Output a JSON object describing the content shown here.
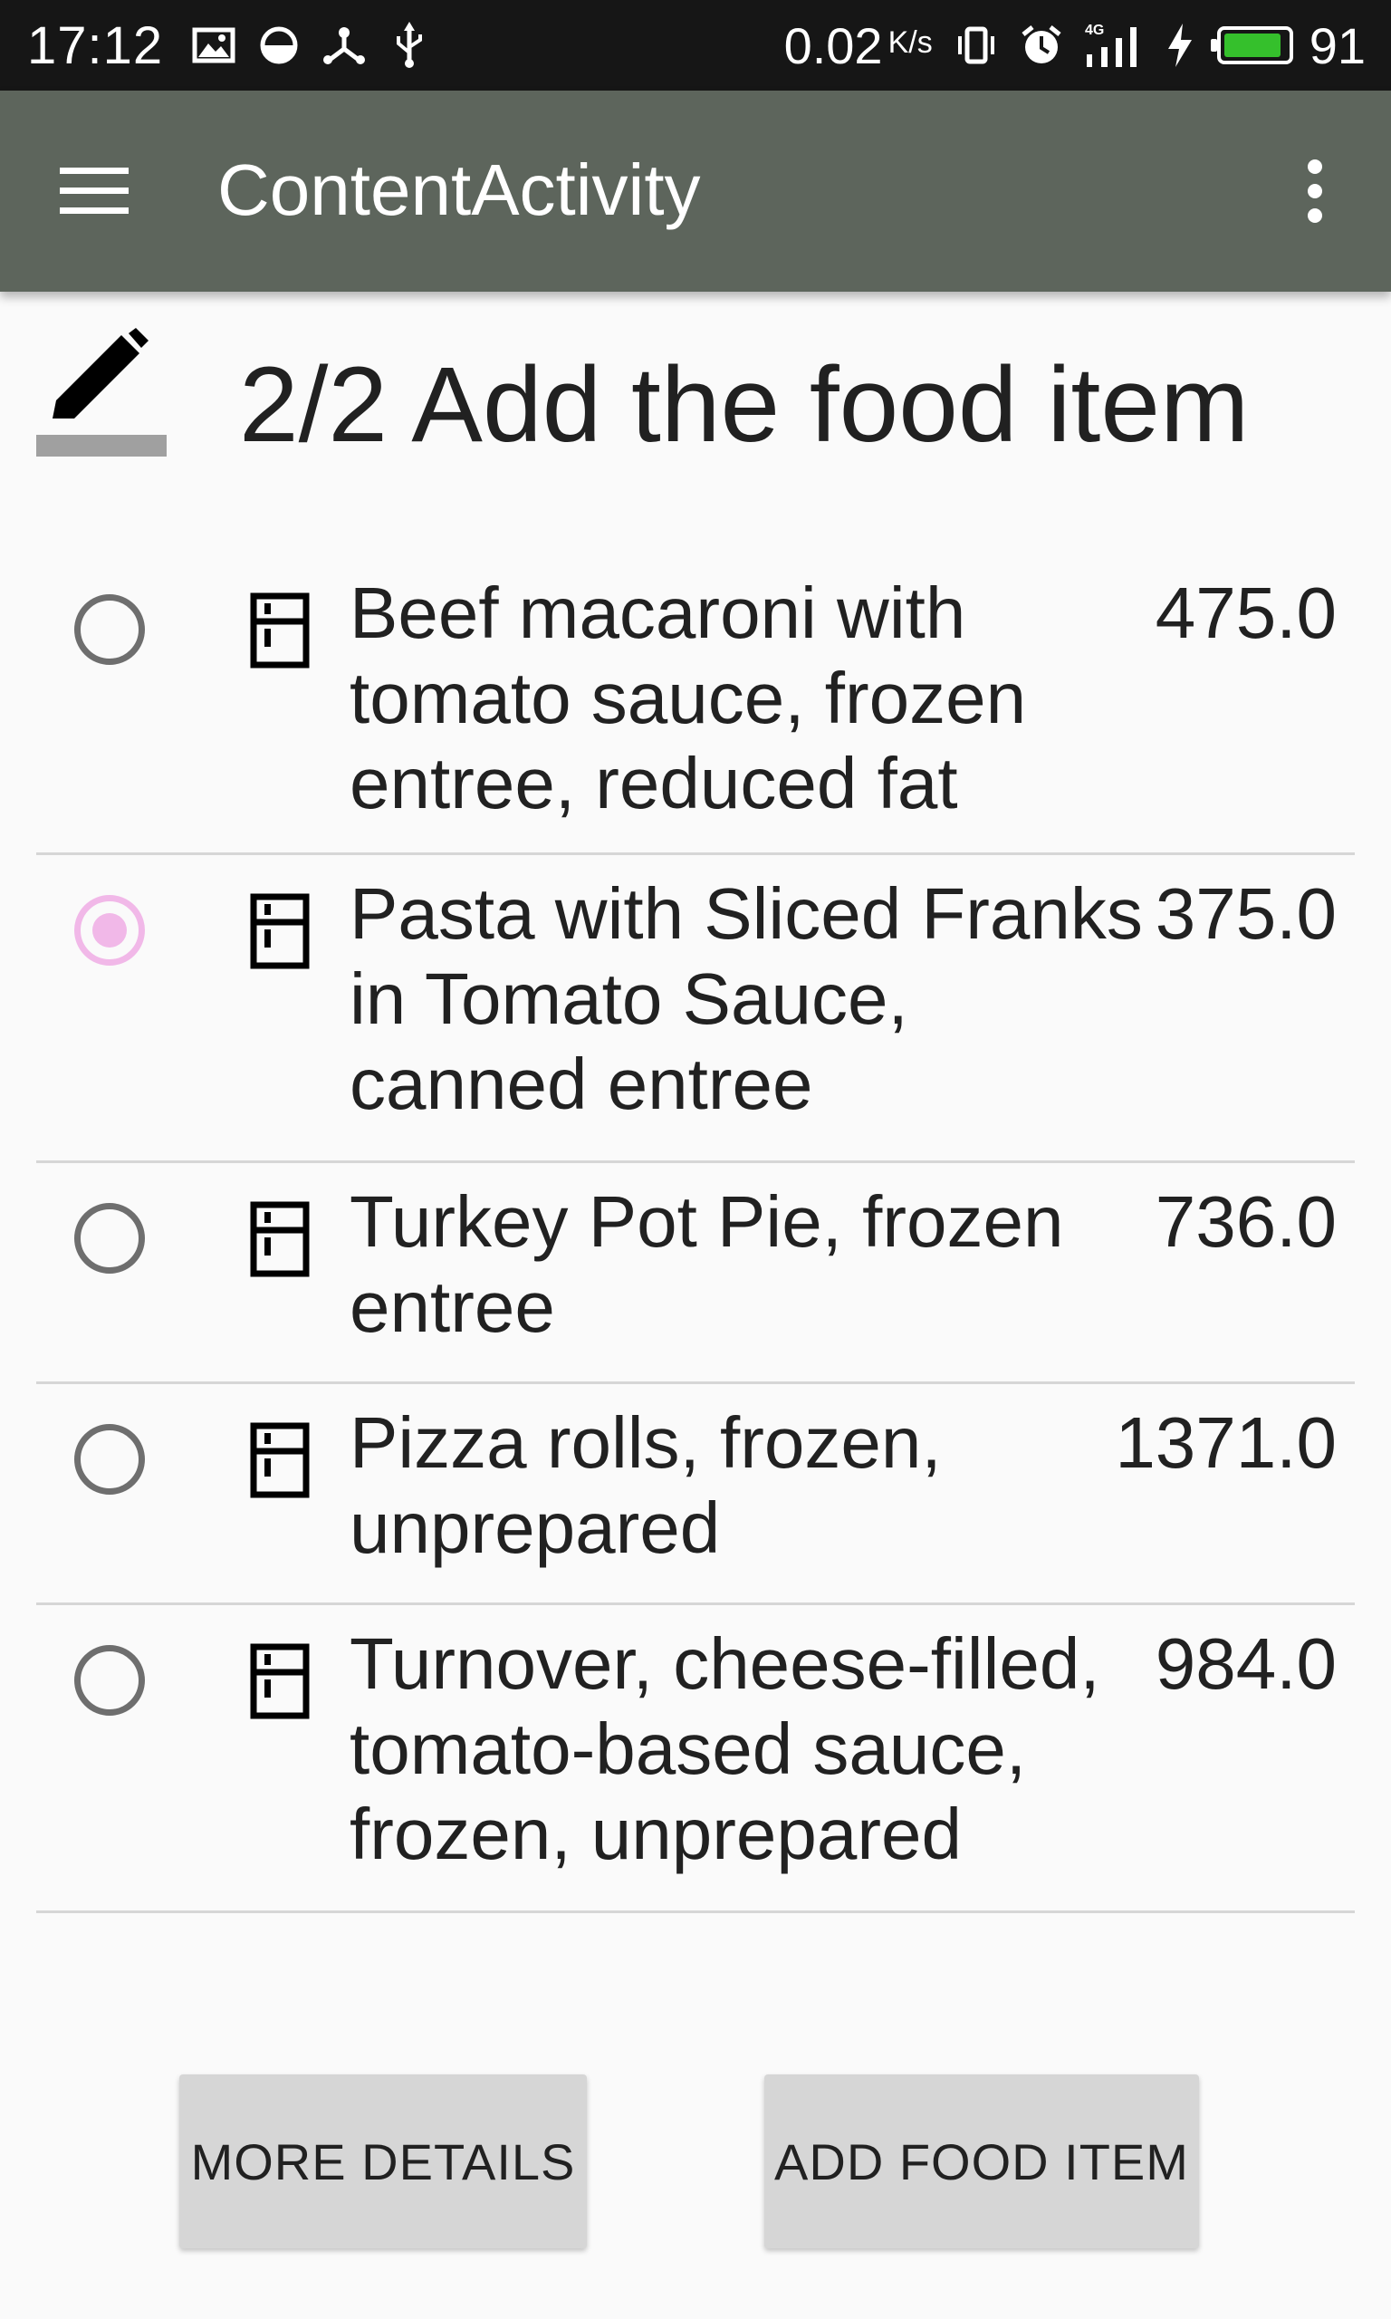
{
  "status_bar": {
    "time": "17:12",
    "speed": "0.02",
    "speed_unit": "K/s",
    "network": "4G",
    "battery_percent": "91",
    "battery_level": 0.91,
    "icons": [
      "image-icon",
      "sync-icon",
      "usb-share-icon",
      "usb-icon",
      "vibrate-icon",
      "alarm-icon",
      "signal-icon",
      "charging-icon",
      "battery-icon"
    ]
  },
  "toolbar": {
    "title": "ContentActivity",
    "menu_icon": "hamburger-menu-icon",
    "overflow_icon": "more-vert-icon",
    "color": "#5d655c"
  },
  "header": {
    "title": "2/2 Add the food item",
    "icon": "edit-icon"
  },
  "food_items": [
    {
      "name": "Beef macaroni with tomato sauce, frozen entree, reduced fat",
      "value": "475.0",
      "selected": false
    },
    {
      "name": "Pasta with Sliced Franks in Tomato Sauce, canned entree",
      "value": "375.0",
      "selected": true
    },
    {
      "name": "Turkey Pot Pie, frozen entree",
      "value": "736.0",
      "selected": false
    },
    {
      "name": "Pizza rolls, frozen, unprepared",
      "value": "1371.0",
      "selected": false
    },
    {
      "name": "Turnover, cheese-filled, tomato-based sauce, frozen, unprepared",
      "value": "984.0",
      "selected": false
    }
  ],
  "buttons": {
    "more_details": "MORE DETAILS",
    "add_food_item": "ADD FOOD ITEM"
  },
  "colors": {
    "selected_radio": "#f1b8e8",
    "button_bg": "#d6d6d6"
  }
}
